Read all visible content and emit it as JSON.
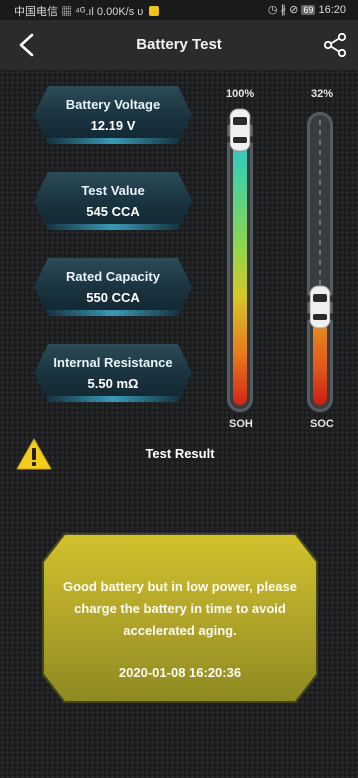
{
  "status_bar": {
    "carrier": "中国电信",
    "speed": "0.00K/s",
    "battery": "69",
    "time": "16:20"
  },
  "header": {
    "title": "Battery Test",
    "back_icon": "back-chevron-icon",
    "share_icon": "share-icon"
  },
  "metrics": [
    {
      "label": "Battery Voltage",
      "value": "12.19 V"
    },
    {
      "label": "Test Value",
      "value": "545 CCA"
    },
    {
      "label": "Rated Capacity",
      "value": "550 CCA"
    },
    {
      "label": "Internal Resistance",
      "value": "5.50 mΩ"
    }
  ],
  "gauges": {
    "soh": {
      "label": "SOH",
      "percent_text": "100%",
      "level": 1.0
    },
    "soc": {
      "label": "SOC",
      "percent_text": "32%",
      "level": 0.32
    }
  },
  "result": {
    "title": "Test Result",
    "message": "Good battery but in low power, please charge the battery in time to avoid accelerated aging.",
    "timestamp": "2020-01-08  16:20:36",
    "warning_icon": "warning-icon"
  },
  "colors": {
    "panel": "#c4b52b",
    "badge": "#1f3d4a",
    "accent": "#3ea7c6"
  }
}
